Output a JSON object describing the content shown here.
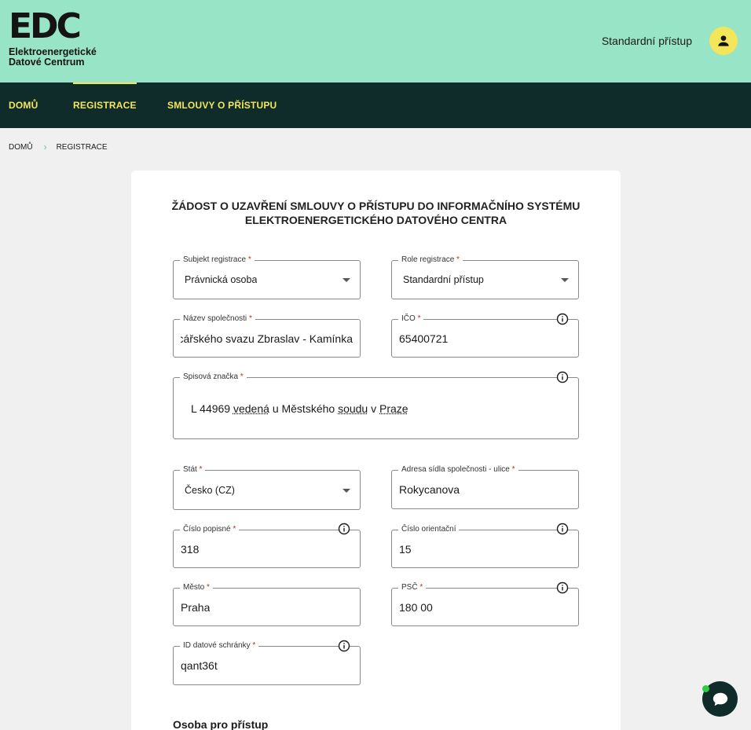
{
  "header": {
    "logo_mark": "EDC",
    "logo_line1": "Elektroenergetické",
    "logo_line2": "Datové Centrum",
    "user_role": "Standardní přístup",
    "avatar_icon": "person-icon"
  },
  "nav": {
    "items": [
      {
        "label": "DOMŮ",
        "active": false
      },
      {
        "label": "REGISTRACE",
        "active": true
      },
      {
        "label": "SMLOUVY O PŘÍSTUPU",
        "active": false
      }
    ]
  },
  "breadcrumb": {
    "home": "DOMŮ",
    "current": "REGISTRACE"
  },
  "form": {
    "title": "ŽÁDOST O UZAVŘENÍ SMLOUVY O PŘÍSTUPU DO INFORMAČNÍHO SYSTÉMU ELEKTROENERGETICKÉHO DATOVÉHO CENTRA",
    "required_mark": "*",
    "subject": {
      "label": "Subjekt registrace",
      "value": "Právnická osoba"
    },
    "role": {
      "label": "Role registrace",
      "value": "Standardní přístup"
    },
    "company_name": {
      "label": "Název společnosti",
      "value": "cářského svazu Zbraslav - Kamínka"
    },
    "ico": {
      "label": "IČO",
      "value": "65400721"
    },
    "file_mark": {
      "label": "Spisová značka",
      "words": [
        "L 44969",
        "vedená",
        "u Městského",
        "soudu",
        "v",
        "Praze"
      ]
    },
    "country": {
      "label": "Stát",
      "value": "Česko (CZ)"
    },
    "street": {
      "label": "Adresa sídla společnosti - ulice",
      "value": "Rokycanova"
    },
    "house_number": {
      "label": "Číslo popisné",
      "value": "318"
    },
    "orientation_number": {
      "label": "Číslo orientační",
      "value": "15"
    },
    "city": {
      "label": "Město",
      "value": "Praha"
    },
    "zip": {
      "label": "PSČ",
      "value": "180 00"
    },
    "databox": {
      "label": "ID datové schránky",
      "value": "qant36t"
    },
    "section_access_person": "Osoba pro přístup"
  },
  "chat": {
    "icon": "chat-bubble-icon",
    "status_color": "#2ecc40"
  }
}
